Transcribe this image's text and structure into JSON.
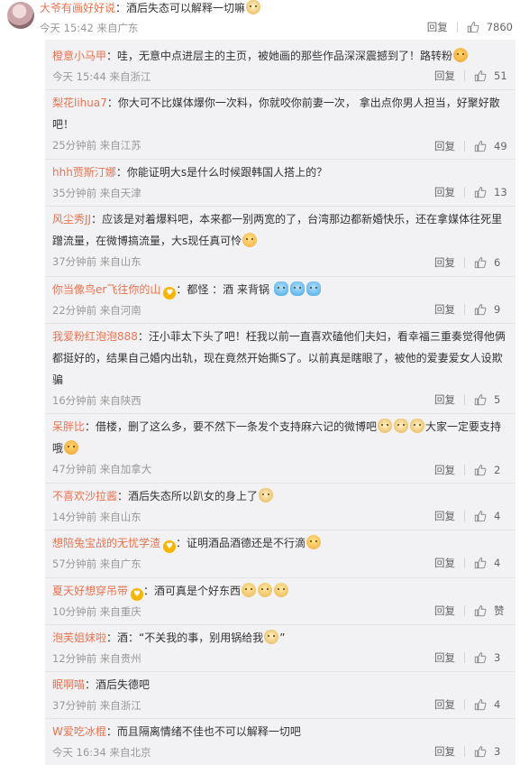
{
  "main_comment": {
    "username": "大爷有画好好说",
    "text": "：酒后失态可以解释一切嘛",
    "emoji": [
      "cat-face-emoji"
    ],
    "time": "今天 15:42",
    "location": "来自广东",
    "reply_label": "回复",
    "likes": "7860"
  },
  "replies": [
    {
      "username": "橙意小马甲",
      "text": "：哇，无意中点进层主的主页，被她画的那些作品深深震撼到了！路转粉",
      "emoji_after": [
        "kiss-emoji"
      ],
      "time": "今天 15:44",
      "location": "来自浙江",
      "reply_label": "回复",
      "likes": "51"
    },
    {
      "username": "梨花lihua7",
      "text": "：你大可不比媒体爆你一次料，你就咬你前妻一次， 拿出点你男人担当，好聚好散吧！",
      "emoji_after": [],
      "time": "25分钟前",
      "location": "来自江苏",
      "reply_label": "回复",
      "likes": "49"
    },
    {
      "username": "hhh贾斯汀娜",
      "text": "：你能证明大s是什么时候跟韩国人搭上的？",
      "emoji_after": [],
      "time": "35分钟前",
      "location": "来自天津",
      "reply_label": "回复",
      "likes": "13"
    },
    {
      "username": "风尘秀JJ",
      "text": "：应该是对着爆料吧，本来都一别两宽的了，台湾那边都新婚快乐，还在拿媒体往死里蹭流量，在微博搞流量，大s现任真可怜",
      "emoji_after": [
        "laugh-cry-emoji"
      ],
      "time": "37分钟前",
      "location": "来自山东",
      "reply_label": "回复",
      "likes": "6"
    },
    {
      "username": "你当像鸟er飞往你的山",
      "text": "：都怪 ：酒 来背锅",
      "emoji_after": [
        "fans-emoji",
        "fans-emoji",
        "fans-emoji"
      ],
      "badge": true,
      "time": "22分钟前",
      "location": "来自河南",
      "reply_label": "回复",
      "likes": "9"
    },
    {
      "username": "我爱粉红泡泡888",
      "text": "：汪小菲太下头了吧！枉我以前一直喜欢磕他们夫妇，看幸福三重奏觉得他俩都挺好的，结果自己婚内出轨，现在竟然开始撕S了。以前真是瞎眼了，被他的爱妻爱女人设欺骗",
      "emoji_after": [],
      "time": "16分钟前",
      "location": "来自陕西",
      "reply_label": "回复",
      "likes": "5"
    },
    {
      "username": "呆胖比",
      "text": "：借楼，删了这么多，要不然下一条发个支持麻六记的微博吧",
      "emoji_after": [
        "cat-face-emoji",
        "cat-face-emoji",
        "cat-face-emoji"
      ],
      "text2": "大家一定要支持哦",
      "emoji_end": [
        "kiss-emoji"
      ],
      "time": "47分钟前",
      "location": "来自加拿大",
      "reply_label": "回复",
      "likes": "2"
    },
    {
      "username": "不喜欢沙拉酱",
      "text": "：酒后失态所以趴女的身上了",
      "emoji_after": [
        "cat-face-emoji"
      ],
      "time": "14分钟前",
      "location": "来自山东",
      "reply_label": "回复",
      "likes": "4"
    },
    {
      "username": "想陪兔宝战的无忧学渣",
      "text": "：证明酒品酒德还是不行滴",
      "emoji_after": [
        "laugh-cry-emoji"
      ],
      "badge": true,
      "time": "57分钟前",
      "location": "来自广东",
      "reply_label": "回复",
      "likes": "4"
    },
    {
      "username": "夏天好想穿吊带",
      "text": "：酒可真是个好东西",
      "emoji_after": [
        "sad-emoji",
        "sad-emoji",
        "sad-emoji"
      ],
      "badge": true,
      "time": "10分钟前",
      "location": "来自重庆",
      "reply_label": "回复",
      "likes": "赞"
    },
    {
      "username": "泡芙姐妹啦",
      "text": "：酒：“不关我的事，别用锅给我",
      "emoji_after": [
        "cat-face-emoji"
      ],
      "text2": "”",
      "time": "12分钟前",
      "location": "来自贵州",
      "reply_label": "回复",
      "likes": "3"
    },
    {
      "username": "眠啊喵",
      "text": "：酒后失德吧",
      "emoji_after": [],
      "time": "37分钟前",
      "location": "来自浙江",
      "reply_label": "回复",
      "likes": "4"
    },
    {
      "username": "W爱吃冰棍",
      "text": "：而且隔离情绪不佳也不可以解释一切吧",
      "emoji_after": [],
      "time": "今天 16:34",
      "location": "来自北京",
      "reply_label": "回复",
      "likes": "3"
    }
  ],
  "colors": {
    "username": "#eb7350",
    "reply_bg": "#f2f2f5",
    "meta": "#999999"
  },
  "icons": {
    "like": "thumbs-up-icon"
  }
}
